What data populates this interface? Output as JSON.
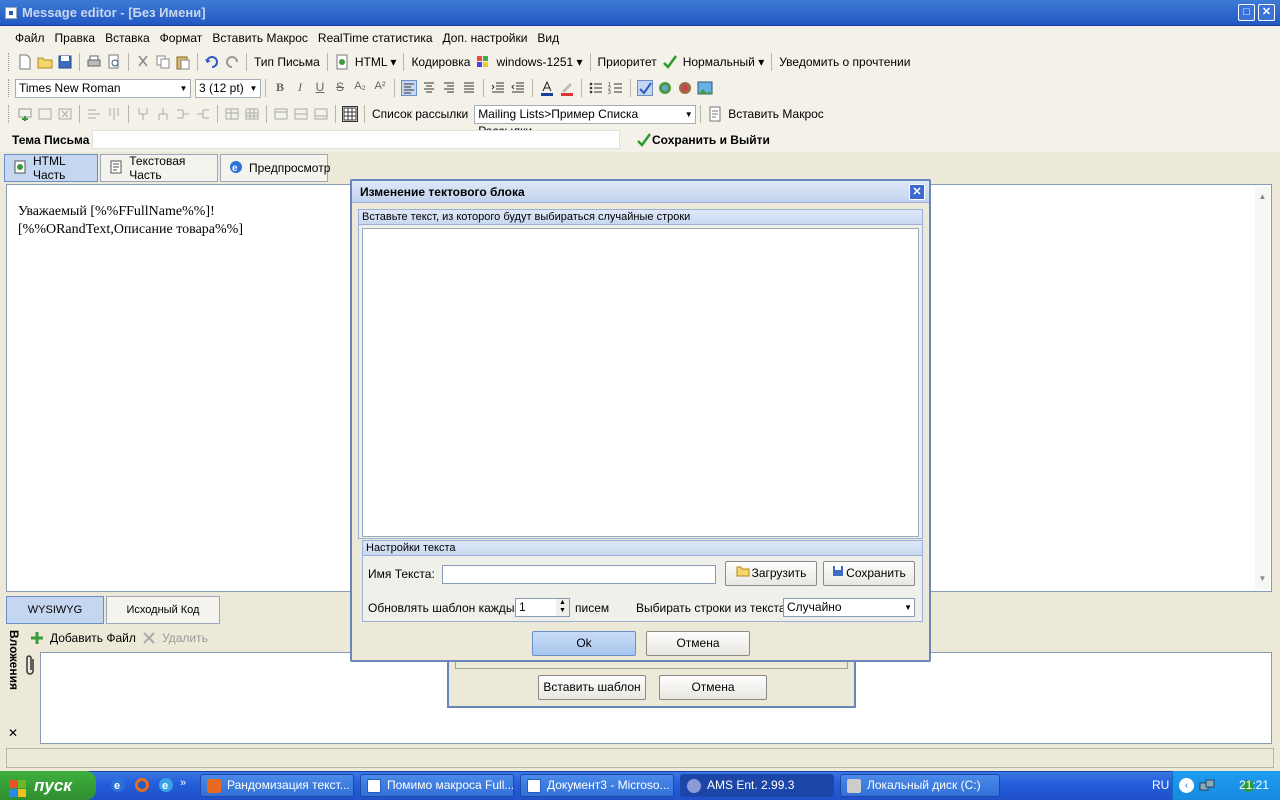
{
  "window": {
    "title": "Message editor - [Без Имени]"
  },
  "menu": [
    "Файл",
    "Правка",
    "Вставка",
    "Формат",
    "Вставить Макрос",
    "RealTime статистика",
    "Доп. настройки",
    "Вид"
  ],
  "toolbar1": {
    "letter_type": "Тип Письма",
    "format": "HTML",
    "encoding_label": "Кодировка",
    "encoding_value": "windows-1251",
    "priority_label": "Приоритет",
    "priority_value": "Нормальный",
    "notify": "Уведомить о прочтении"
  },
  "toolbar2": {
    "font": "Times New Roman",
    "size": "3  (12 pt)"
  },
  "toolbar3": {
    "mailing_label": "Список рассылки",
    "mailing_value": "Mailing Lists>Пример Списка Рассылки",
    "insert_macro": "Вставить Макрос"
  },
  "subject": {
    "label": "Тема Письма",
    "value": "",
    "save_exit": "Сохранить и Выйти"
  },
  "tabs": [
    "HTML Часть",
    "Текстовая Часть",
    "Предпросмотр"
  ],
  "editor": {
    "line1": "Уважаемый [%%FFullName%%]!",
    "line2": "[%%ORandText,Описание товара%%]"
  },
  "bottom_tabs": [
    "WYSIWYG",
    "Исходный Код"
  ],
  "attachments": {
    "title": "Вложения",
    "add": "Добавить Файл",
    "delete": "Удалить",
    "close": "✕"
  },
  "bg_dialog": {
    "insert": "Вставить шаблон",
    "cancel": "Отмена"
  },
  "dialog": {
    "title": "Изменение тектового блока",
    "close": "✕",
    "paste_header": "Вставьте текст, из которого будут выбираться случайные строки",
    "settings_header": "Настройки текста",
    "name_label": "Имя Текста:",
    "name_value": "",
    "load": "Загрузить",
    "save": "Сохранить",
    "update_label": "Обновлять шаблон каждые:",
    "update_value": "1",
    "update_unit": "писем",
    "choose_label": "Выбирать строки из текста:",
    "choose_value": "Случайно",
    "ok": "Ok",
    "cancel": "Отмена"
  },
  "taskbar": {
    "start": "пуск",
    "tasks": [
      "Рандомизация текст...",
      "Помимо макроса Full...",
      "Документ3 - Microso...",
      "AMS Ent. 2.99.3",
      "Локальный диск (C:)"
    ],
    "lang": "RU",
    "clock": "21:21"
  }
}
